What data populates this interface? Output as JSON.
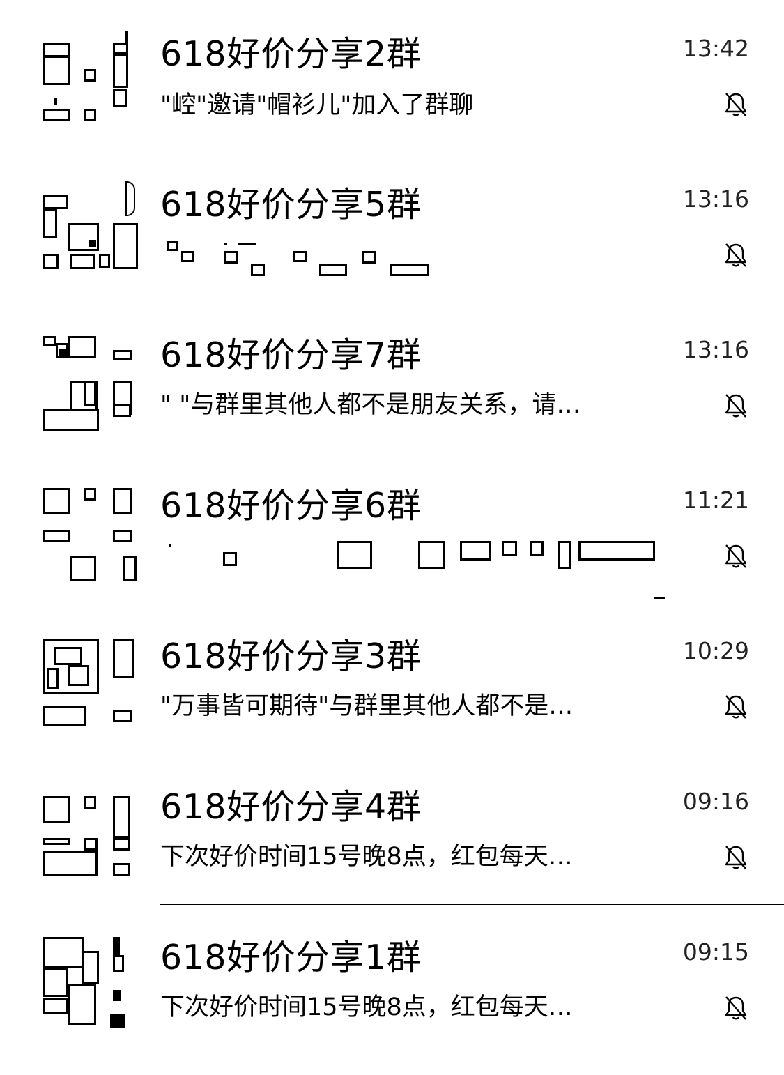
{
  "chats": [
    {
      "name": "618好价分享2群",
      "time": "13:42",
      "preview": "\"崆\"邀请\"帽衫儿\"加入了群聊",
      "muted_icon": "bell-slash-icon"
    },
    {
      "name": "618好价分享5群",
      "time": "13:16",
      "preview": "",
      "muted_icon": "bell-slash-icon"
    },
    {
      "name": "618好价分享7群",
      "time": "13:16",
      "preview": "\"  \"与群里其他人都不是朋友关系，请…",
      "muted_icon": "bell-slash-icon"
    },
    {
      "name": "618好价分享6群",
      "time": "11:21",
      "preview": "",
      "muted_icon": "bell-slash-icon"
    },
    {
      "name": "618好价分享3群",
      "time": "10:29",
      "preview": "\"万事皆可期待\"与群里其他人都不是…",
      "muted_icon": "bell-slash-icon"
    },
    {
      "name": "618好价分享4群",
      "time": "09:16",
      "preview": "下次好价时间15号晚8点，红包每天…",
      "muted_icon": "bell-slash-icon"
    },
    {
      "name": "618好价分享1群",
      "time": "09:15",
      "preview": "下次好价时间15号晚8点，红包每天…",
      "muted_icon": "bell-slash-icon"
    }
  ]
}
